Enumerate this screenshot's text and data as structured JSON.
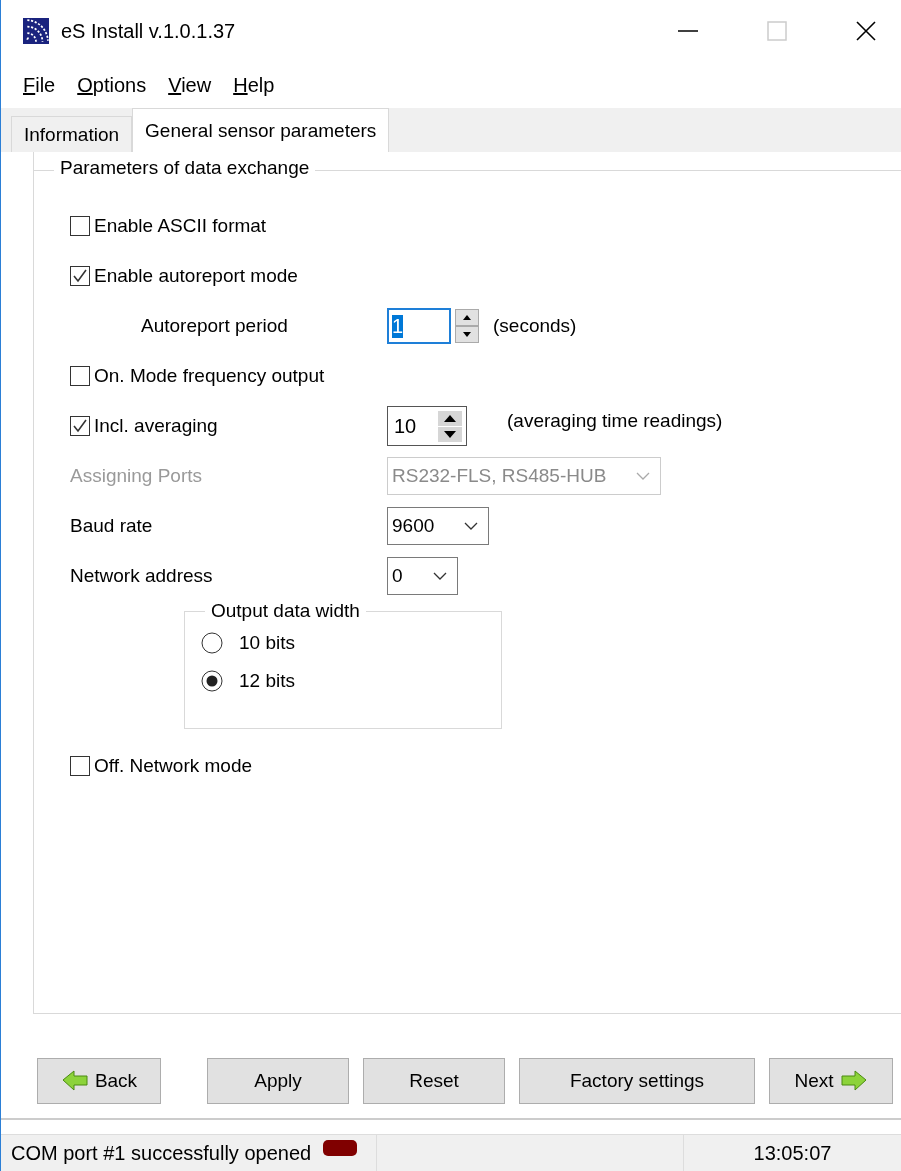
{
  "window": {
    "title": "eS Install v.1.0.1.37"
  },
  "menu": [
    {
      "label": "File"
    },
    {
      "label": "Options"
    },
    {
      "label": "View"
    },
    {
      "label": "Help"
    }
  ],
  "tabs": [
    {
      "label": "Information",
      "selected": false
    },
    {
      "label": "General sensor parameters",
      "selected": true
    }
  ],
  "group": {
    "title": "Parameters of data exchange",
    "rows": [
      {
        "kind": "checkbox",
        "label": "Enable ASCII format",
        "checked": false
      },
      {
        "kind": "checkbox",
        "label": "Enable autoreport mode",
        "checked": true
      },
      {
        "kind": "spin",
        "label": "Autoreport period",
        "value": "1",
        "unit": "(seconds)"
      },
      {
        "kind": "checkbox",
        "label": "On. Mode frequency output",
        "checked": false
      },
      {
        "kind": "checkbox_spin",
        "label": "Incl. averaging",
        "checked": true,
        "value": "10",
        "unit": "(averaging time readings)"
      },
      {
        "kind": "combo",
        "label": "Assigning Ports",
        "value": "RS232-FLS, RS485-HUB",
        "disabled": true
      },
      {
        "kind": "combo",
        "label": "Baud rate",
        "value": "9600",
        "disabled": false
      },
      {
        "kind": "combo",
        "label": "Network address",
        "value": "0",
        "disabled": false
      },
      {
        "kind": "radio_group",
        "title": "Output data width",
        "options": [
          {
            "label": "10 bits",
            "selected": false
          },
          {
            "label": "12 bits",
            "selected": true
          }
        ]
      },
      {
        "kind": "checkbox",
        "label": "Off. Network mode",
        "checked": false
      }
    ]
  },
  "buttons": [
    {
      "label": "Back",
      "kind": "back"
    },
    {
      "label": "Apply",
      "kind": "plain"
    },
    {
      "label": "Reset",
      "kind": "plain"
    },
    {
      "label": "Factory settings",
      "kind": "plain"
    },
    {
      "label": "Next",
      "kind": "next"
    }
  ],
  "status_bar": {
    "message": "COM port #1 successfully opened",
    "time": "13:05:07"
  }
}
